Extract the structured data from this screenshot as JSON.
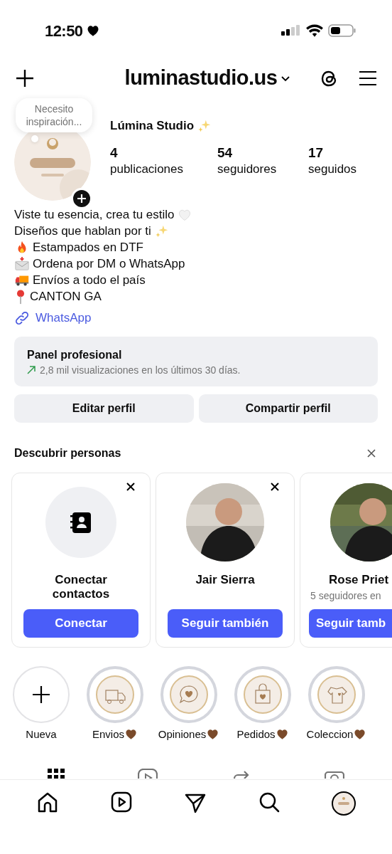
{
  "status_bar": {
    "time": "12:50"
  },
  "header": {
    "username": "luminastudio.us"
  },
  "profile": {
    "note": "Necesito inspiración...",
    "name": [
      {
        "kind": "text",
        "text": "Lúmina Studio"
      },
      {
        "kind": "sparkles"
      }
    ],
    "stats": [
      {
        "value": "4",
        "label": "publicaciones"
      },
      {
        "value": "54",
        "label": "seguidores"
      },
      {
        "value": "17",
        "label": "seguidos"
      }
    ]
  },
  "bio": [
    {
      "parts": [
        {
          "kind": "text",
          "text": "Viste tu esencia, crea tu estilo"
        },
        {
          "kind": "heart"
        }
      ]
    },
    {
      "parts": [
        {
          "kind": "text",
          "text": "Diseños que hablan por ti"
        },
        {
          "kind": "sparkles"
        }
      ]
    },
    {
      "parts": [
        {
          "kind": "fire"
        },
        {
          "kind": "text",
          "text": "Estampados en DTF"
        }
      ]
    },
    {
      "parts": [
        {
          "kind": "envelope"
        },
        {
          "kind": "text",
          "text": "Ordena por DM o WhatsApp"
        }
      ]
    },
    {
      "parts": [
        {
          "kind": "truck"
        },
        {
          "kind": "text",
          "text": "Envíos a todo el país"
        }
      ]
    },
    {
      "parts": [
        {
          "kind": "pin"
        },
        {
          "kind": "text",
          "text": "CANTON GA"
        }
      ]
    }
  ],
  "link": "WhatsApp",
  "panel": {
    "title": "Panel profesional",
    "stat": "2,8 mil visualizaciones en los últimos 30 días."
  },
  "buttons": [
    "Editar perfil",
    "Compartir perfil"
  ],
  "discover": {
    "title": "Descubrir personas",
    "cards": [
      {
        "kind": "contacts",
        "name": "Conectar contactos",
        "button": "Conectar",
        "dismissible": true
      },
      {
        "kind": "person",
        "name": "Jair Sierra",
        "button": "Seguir también",
        "dismissible": true
      },
      {
        "kind": "person",
        "name": "Rose Priet",
        "subtitle": "5 seguidores en",
        "button": "Seguir tamb",
        "dismissible": false
      }
    ]
  },
  "highlights": [
    {
      "kind": "new",
      "label": "Nueva"
    },
    {
      "kind": "truck",
      "label": "Envios",
      "heart": true
    },
    {
      "kind": "chat",
      "label": "Opiniones",
      "heart": true
    },
    {
      "kind": "bag",
      "label": "Pedidos",
      "heart": true
    },
    {
      "kind": "shirt",
      "label": "Coleccion",
      "heart": true
    }
  ]
}
